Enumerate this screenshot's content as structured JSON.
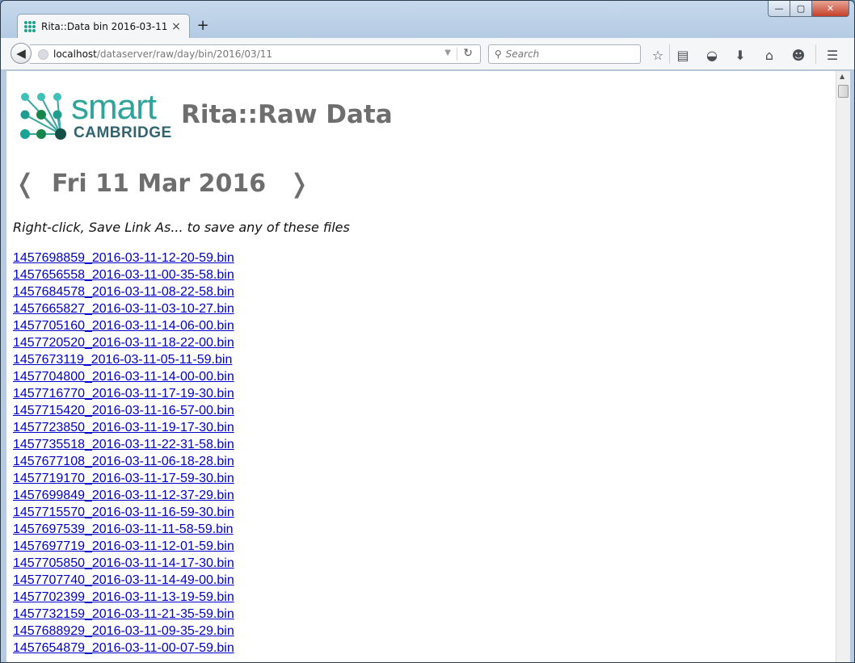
{
  "browser": {
    "tab_title": "Rita::Data bin 2016-03-11",
    "close_tab": "×",
    "new_tab": "+",
    "url_host": "localhost",
    "url_path": "/dataserver/raw/day/bin/2016/03/11",
    "search_placeholder": "Search",
    "caption": {
      "min": "—",
      "max": "▢",
      "close": "✕"
    }
  },
  "page": {
    "logo_word": "smart",
    "logo_sub": "CAMBRIDGE",
    "brand_title": "Rita::Raw Data",
    "prev_arrow": "❬",
    "next_arrow": "❭",
    "date_heading": "Fri 11 Mar 2016",
    "instructions": "Right-click, Save Link As... to save any of these files",
    "files": [
      "1457698859_2016-03-11-12-20-59.bin",
      "1457656558_2016-03-11-00-35-58.bin",
      "1457684578_2016-03-11-08-22-58.bin",
      "1457665827_2016-03-11-03-10-27.bin",
      "1457705160_2016-03-11-14-06-00.bin",
      "1457720520_2016-03-11-18-22-00.bin",
      "1457673119_2016-03-11-05-11-59.bin",
      "1457704800_2016-03-11-14-00-00.bin",
      "1457716770_2016-03-11-17-19-30.bin",
      "1457715420_2016-03-11-16-57-00.bin",
      "1457723850_2016-03-11-19-17-30.bin",
      "1457735518_2016-03-11-22-31-58.bin",
      "1457677108_2016-03-11-06-18-28.bin",
      "1457719170_2016-03-11-17-59-30.bin",
      "1457699849_2016-03-11-12-37-29.bin",
      "1457715570_2016-03-11-16-59-30.bin",
      "1457697539_2016-03-11-11-58-59.bin",
      "1457697719_2016-03-11-12-01-59.bin",
      "1457705850_2016-03-11-14-17-30.bin",
      "1457707740_2016-03-11-14-49-00.bin",
      "1457702399_2016-03-11-13-19-59.bin",
      "1457732159_2016-03-11-21-35-59.bin",
      "1457688929_2016-03-11-09-35-29.bin",
      "1457654879_2016-03-11-00-07-59.bin"
    ]
  }
}
